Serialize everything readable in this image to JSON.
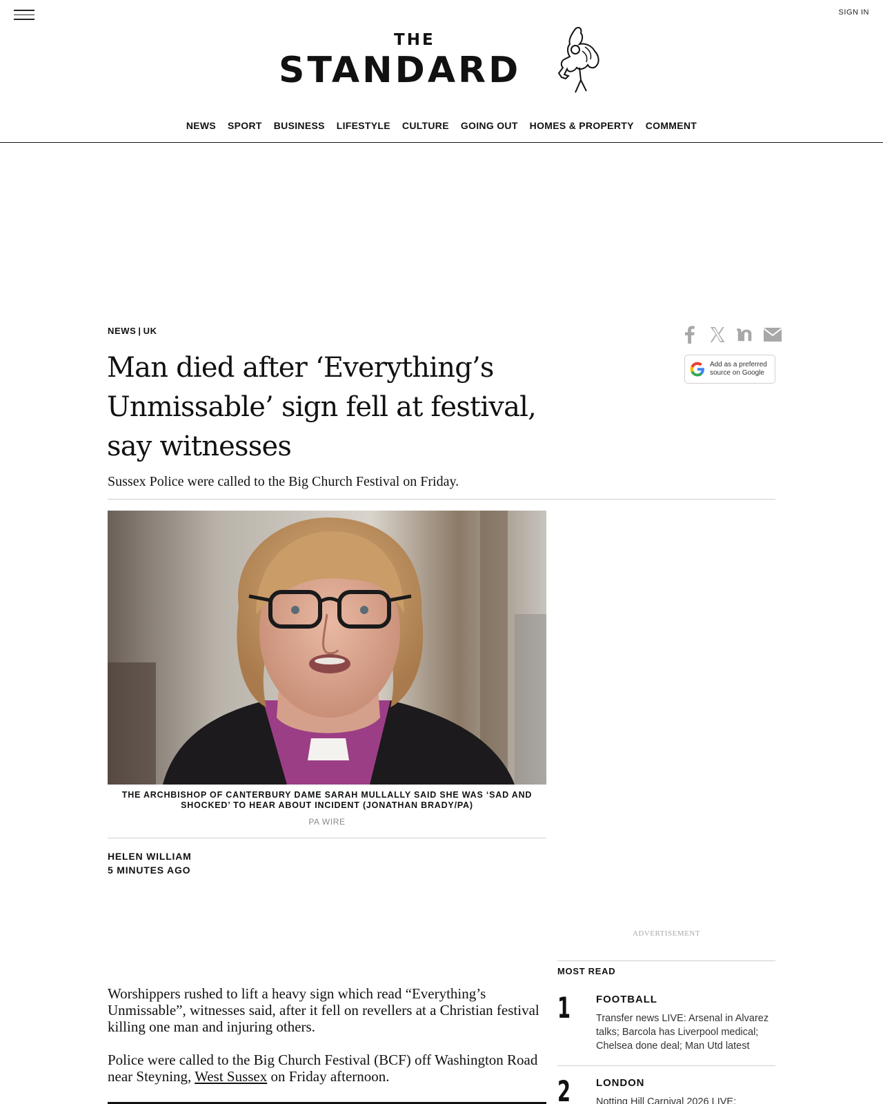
{
  "header": {
    "sign_in": "SIGN IN",
    "logo_the": "THE",
    "logo_name": "STANDARD",
    "nav": [
      "NEWS",
      "SPORT",
      "BUSINESS",
      "LIFESTYLE",
      "CULTURE",
      "GOING OUT",
      "HOMES & PROPERTY",
      "COMMENT"
    ]
  },
  "article": {
    "section": "NEWS",
    "subsection": "UK",
    "headline": "Man died after ‘Everything’s Unmissable’ sign fell at festival, say witnesses",
    "standfirst": "Sussex Police were called to the Big Church Festival on Friday.",
    "caption": "THE ARCHBISHOP OF CANTERBURY DAME SARAH MULLALLY SAID SHE WAS ‘SAD AND SHOCKED’ TO HEAR ABOUT INCIDENT (JONATHAN BRADY/PA)",
    "credit": "PA WIRE",
    "author": "HELEN WILLIAM",
    "time": "5 MINUTES AGO",
    "para1": "Worshippers rushed to lift a heavy sign which read “Everything’s Unmissable”, witnesses said, after it fell on revellers at a Christian festival killing one man and injuring others.",
    "para2_before": "Police were called to the Big Church Festival (BCF) off Washington Road near Steyning, ",
    "para2_link": "West Sussex",
    "para2_after": " on Friday afternoon."
  },
  "share": {
    "icons": [
      "facebook-icon",
      "x-icon",
      "flipboard-icon",
      "email-icon"
    ],
    "google_badge_line1": "Add as a preferred",
    "google_badge_line2": "source on Google"
  },
  "sidebar": {
    "ad_label": "ADVERTISEMENT",
    "most_read_title": "MOST READ",
    "items": [
      {
        "num": "1",
        "category": "FOOTBALL",
        "text": "Transfer news LIVE: Arsenal in Alvarez talks; Barcola has Liverpool medical; Chelsea done deal; Man Utd latest"
      },
      {
        "num": "2",
        "category": "LONDON",
        "text": "Notting Hill Carnival 2026 LIVE:"
      }
    ]
  }
}
